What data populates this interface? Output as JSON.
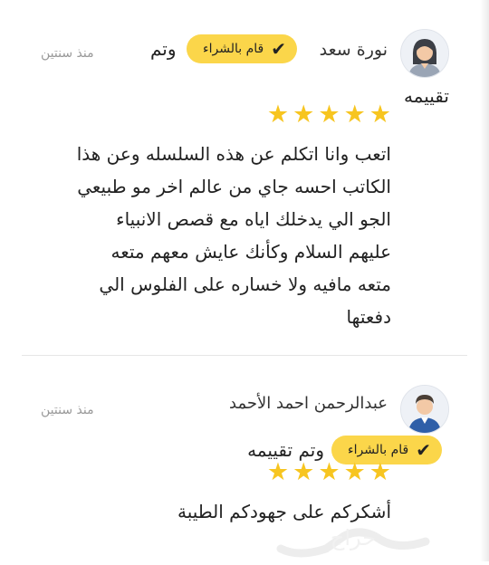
{
  "reviews": [
    {
      "name": "نورة سعد",
      "purchased_badge": "قام بالشراء",
      "badge_suffix": "وتم",
      "badge_suffix_line2": "تقييمه",
      "time": "منذ سنتين",
      "rating": 5,
      "text": "اتعب وانا اتكلم عن هذه السلسله وعن هذا\nالكاتب احسه جاي من عالم اخر مو طبيعي\nالجو الي يدخلك اياه مع قصص الانبياء\nعليهم السلام وكأنك عايش معهم متعه\nمتعه مافيه ولا خساره على الفلوس الي\nدفعتها",
      "avatar_icon": "female-user-avatar-icon"
    },
    {
      "name": "عبدالرحمن احمد الأحمد",
      "purchased_badge": "قام بالشراء",
      "badge_suffix": "وتم تقييمه",
      "time": "منذ سنتين",
      "rating": 5,
      "text": "أشكركم على جهودكم الطيبة",
      "avatar_icon": "male-user-avatar-icon"
    }
  ],
  "colors": {
    "badge": "#fbd64a",
    "star": "#f7c520",
    "muted": "#9a9a9a"
  },
  "watermark": "حراج"
}
